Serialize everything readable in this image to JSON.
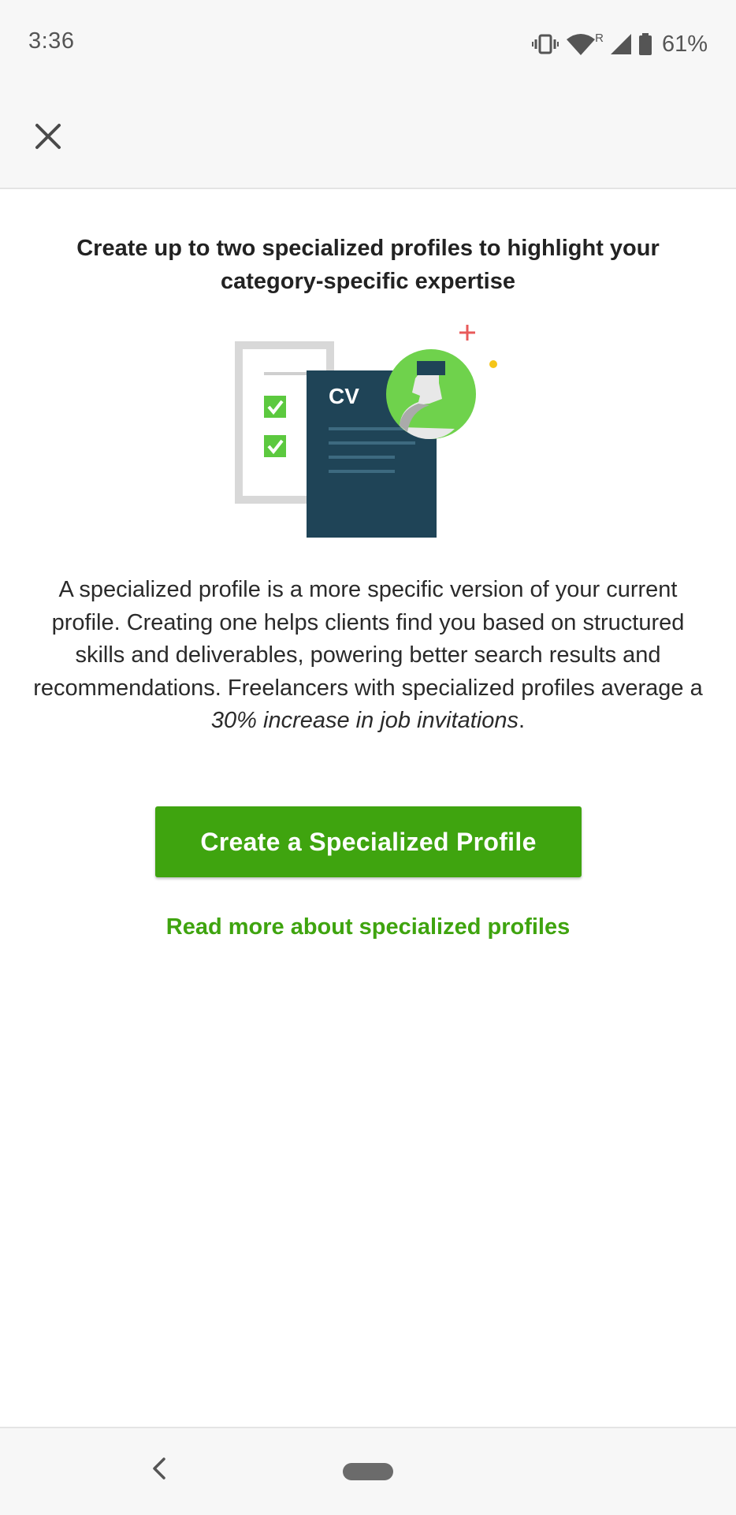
{
  "status_bar": {
    "time": "3:36",
    "battery_percent": "61%",
    "network_roaming_label": "R",
    "icons": [
      "vibrate-icon",
      "wifi-icon",
      "cell-signal-icon",
      "battery-icon"
    ]
  },
  "app_bar": {
    "close_icon": "close-icon"
  },
  "main": {
    "headline": "Create up to two specialized profiles to highlight your category-specific expertise",
    "illustration": {
      "cv_label": "CV"
    },
    "description": {
      "text": "A specialized profile is a more specific version of your current profile. Creating one helps clients find you based on structured skills and deliverables, powering better search results and recommendations. Freelancers with specialized profiles average a ",
      "emphasis": "30% increase in job invitations",
      "trailing": "."
    },
    "primary_button_label": "Create a Specialized Profile",
    "read_more_link": "Read more about specialized profiles"
  },
  "nav_bar": {
    "back_icon": "back-chevron-icon",
    "home_icon": "home-pill-icon"
  },
  "colors": {
    "brand_green": "#3fa40f",
    "cv_navy": "#1f4457",
    "avatar_green": "#6fd24c",
    "chrome_bg": "#f7f7f7"
  }
}
